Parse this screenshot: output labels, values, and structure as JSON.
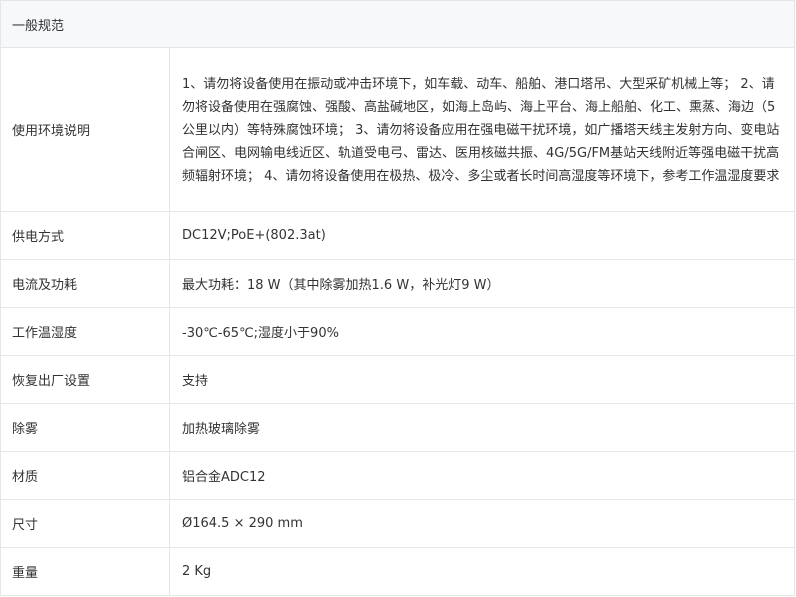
{
  "section": {
    "title": "一般规范"
  },
  "specs": [
    {
      "label": "使用环境说明",
      "value": "1、请勿将设备使用在振动或冲击环境下，如车载、动车、船舶、港口塔吊、大型采矿机械上等； 2、请勿将设备使用在强腐蚀、强酸、高盐碱地区，如海上岛屿、海上平台、海上船舶、化工、熏蒸、海边（5公里以内）等特殊腐蚀环境； 3、请勿将设备应用在强电磁干扰环境，如广播塔天线主发射方向、变电站合闸区、电网输电线近区、轨道受电弓、雷达、医用核磁共振、4G/5G/FM基站天线附近等强电磁干扰高频辐射环境； 4、请勿将设备使用在极热、极冷、多尘或者长时间高湿度等环境下，参考工作温湿度要求"
    },
    {
      "label": "供电方式",
      "value": "DC12V;PoE+(802.3at)"
    },
    {
      "label": "电流及功耗",
      "value": "最大功耗：18 W（其中除雾加热1.6 W，补光灯9 W）"
    },
    {
      "label": "工作温湿度",
      "value": "-30℃-65℃;湿度小于90%"
    },
    {
      "label": "恢复出厂设置",
      "value": "支持"
    },
    {
      "label": "除雾",
      "value": "加热玻璃除雾"
    },
    {
      "label": "材质",
      "value": "铝合金ADC12"
    },
    {
      "label": "尺寸",
      "value": "Ø164.5 × 290 mm"
    },
    {
      "label": "重量",
      "value": "2 Kg"
    }
  ]
}
